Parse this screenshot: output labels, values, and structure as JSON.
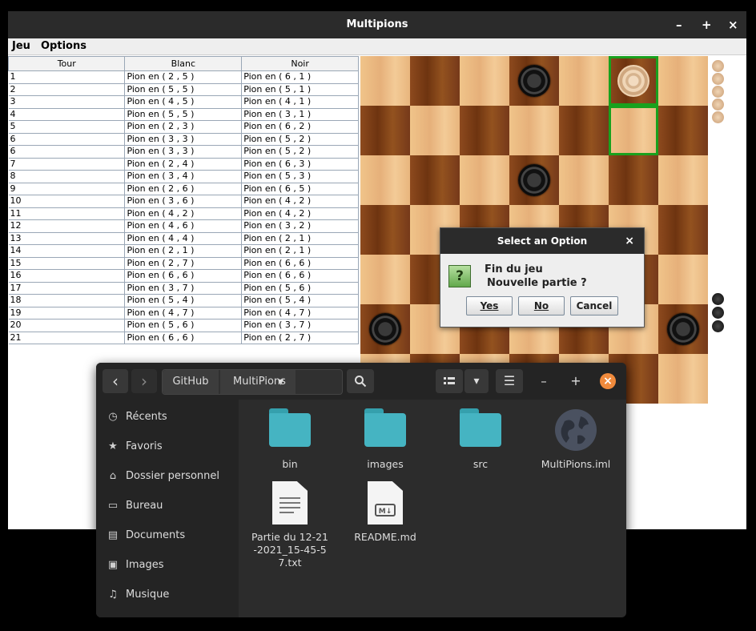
{
  "window": {
    "title": "Multipions",
    "minimize": "–",
    "maximize": "+",
    "close": "×"
  },
  "menu": {
    "jeu": "Jeu",
    "options": "Options"
  },
  "table": {
    "headers": [
      "Tour",
      "Blanc",
      "Noir"
    ],
    "rows": [
      [
        "1",
        "Pion en ( 2 , 5 )",
        "Pion en ( 6 , 1 )"
      ],
      [
        "2",
        "Pion en ( 5 , 5 )",
        "Pion en ( 5 , 1 )"
      ],
      [
        "3",
        "Pion en ( 4 , 5 )",
        "Pion en ( 4 , 1 )"
      ],
      [
        "4",
        "Pion en ( 5 , 5 )",
        "Pion en ( 3 , 1 )"
      ],
      [
        "5",
        "Pion en ( 2 , 3 )",
        "Pion en ( 6 , 2 )"
      ],
      [
        "6",
        "Pion en ( 3 , 3 )",
        "Pion en ( 5 , 2 )"
      ],
      [
        "6",
        "Pion en ( 3 , 3 )",
        "Pion en ( 5 , 2 )"
      ],
      [
        "7",
        "Pion en ( 2 , 4 )",
        "Pion en ( 6 , 3 )"
      ],
      [
        "8",
        "Pion en ( 3 , 4 )",
        "Pion en ( 5 , 3 )"
      ],
      [
        "9",
        "Pion en ( 2 , 6 )",
        "Pion en ( 6 , 5 )"
      ],
      [
        "10",
        "Pion en ( 3 , 6 )",
        "Pion en ( 4 , 2 )"
      ],
      [
        "11",
        "Pion en ( 4 , 2 )",
        "Pion en ( 4 , 2 )"
      ],
      [
        "12",
        "Pion en ( 4 , 6 )",
        "Pion en ( 3 , 2 )"
      ],
      [
        "13",
        "Pion en ( 4 , 4 )",
        "Pion en ( 2 , 1 )"
      ],
      [
        "14",
        "Pion en ( 2 , 1 )",
        "Pion en ( 2 , 1 )"
      ],
      [
        "15",
        "Pion en ( 2 , 7 )",
        "Pion en ( 6 , 6 )"
      ],
      [
        "16",
        "Pion en ( 6 , 6 )",
        "Pion en ( 6 , 6 )"
      ],
      [
        "17",
        "Pion en ( 3 , 7 )",
        "Pion en ( 5 , 6 )"
      ],
      [
        "18",
        "Pion en ( 5 , 4 )",
        "Pion en ( 5 , 4 )"
      ],
      [
        "19",
        "Pion en ( 4 , 7 )",
        "Pion en ( 4 , 7 )"
      ],
      [
        "20",
        "Pion en ( 5 , 6 )",
        "Pion en ( 3 , 7 )"
      ],
      [
        "21",
        "Pion en ( 6 , 6 )",
        "Pion en ( 2 , 7 )"
      ]
    ]
  },
  "board": {
    "colors": {
      "light": "#f0c48a",
      "dark": "#7a3c14",
      "highlight": "#19a11e"
    },
    "pieces": [
      {
        "color": "black",
        "row": 0,
        "col": 3
      },
      {
        "color": "white",
        "row": 0,
        "col": 5
      },
      {
        "color": "black",
        "row": 2,
        "col": 3
      },
      {
        "color": "black",
        "row": 5,
        "col": 0
      },
      {
        "color": "black",
        "row": 5,
        "col": 6
      }
    ],
    "highlighted": [
      {
        "row": 0,
        "col": 5
      },
      {
        "row": 1,
        "col": 5
      }
    ],
    "captured_white": 5,
    "captured_black": 3
  },
  "dialog": {
    "title": "Select an Option",
    "close": "×",
    "icon": "?",
    "message_line1": "Fin du jeu",
    "message_line2": "Nouvelle partie ?",
    "yes": "Yes",
    "no": "No",
    "cancel": "Cancel"
  },
  "file_manager": {
    "back": "‹",
    "forward": "›",
    "path": [
      "GitHub",
      "MultiPions"
    ],
    "path_dropdown": "▾",
    "search_icon": "search-icon",
    "view_toggle": "▾",
    "menu": "☰",
    "min": "–",
    "max": "+",
    "close": "×",
    "sidebar": [
      {
        "icon": "◷",
        "label": "Récents"
      },
      {
        "icon": "★",
        "label": "Favoris"
      },
      {
        "icon": "⌂",
        "label": "Dossier personnel"
      },
      {
        "icon": "▭",
        "label": "Bureau"
      },
      {
        "icon": "▤",
        "label": "Documents"
      },
      {
        "icon": "▣",
        "label": "Images"
      },
      {
        "icon": "♫",
        "label": "Musique"
      }
    ],
    "files": [
      {
        "type": "folder",
        "name": "bin"
      },
      {
        "type": "folder",
        "name": "images"
      },
      {
        "type": "folder",
        "name": "src"
      },
      {
        "type": "globe",
        "name": "MultiPions.iml"
      },
      {
        "type": "text",
        "name": "Partie du 12-21-2021_15-45-57.txt"
      },
      {
        "type": "md",
        "name": "README.md"
      }
    ],
    "accent": "#f08a3c"
  }
}
